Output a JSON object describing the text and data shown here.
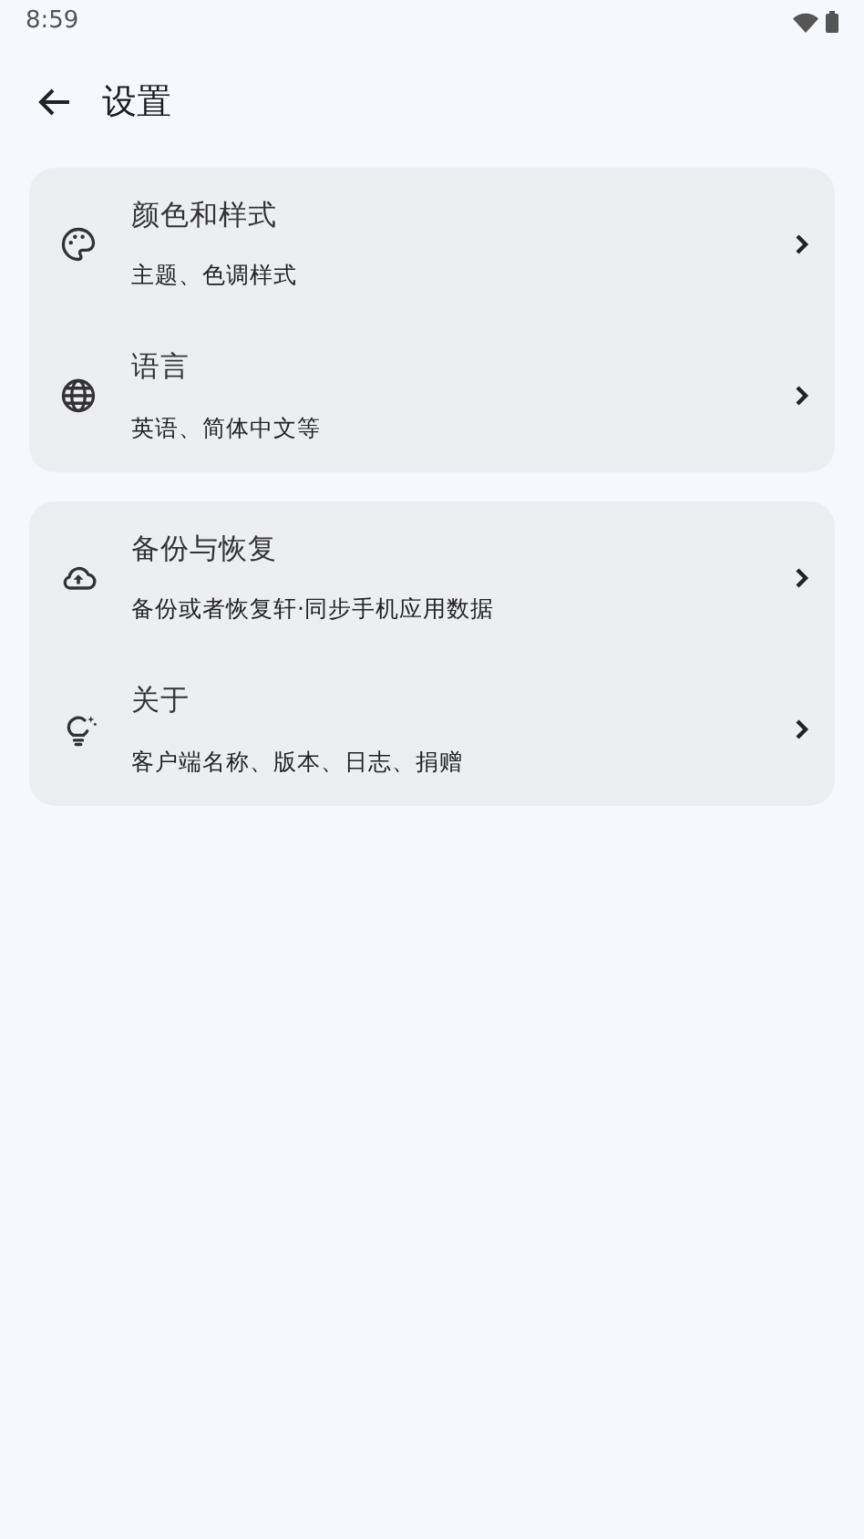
{
  "status_bar": {
    "time": "8:59"
  },
  "header": {
    "title": "设置"
  },
  "groups": [
    {
      "items": [
        {
          "kind": "palette",
          "title": "颜色和样式",
          "subtitle": "主题、色调样式"
        },
        {
          "kind": "globe",
          "title": "语言",
          "subtitle": "英语、简体中文等"
        }
      ]
    },
    {
      "items": [
        {
          "kind": "cloud",
          "title": "备份与恢复",
          "subtitle": "备份或者恢复轩·同步手机应用数据"
        },
        {
          "kind": "bulb",
          "title": "关于",
          "subtitle": "客户端名称、版本、日志、捐赠"
        }
      ]
    }
  ]
}
